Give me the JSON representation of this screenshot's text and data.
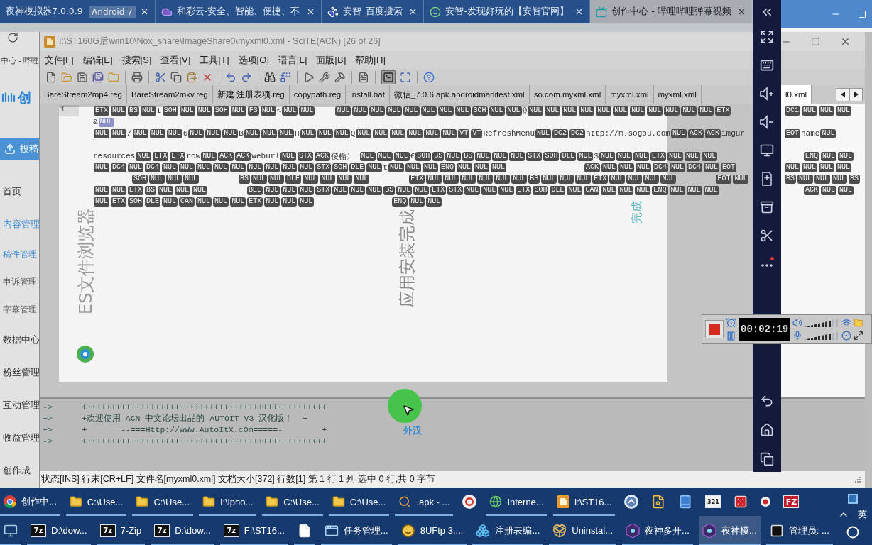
{
  "browser": {
    "tabs": [
      {
        "kind": "plain",
        "title": "夜神模拟器7.0.0.9",
        "subtitle": "Android 7",
        "selected": false
      },
      {
        "kind": "cloud",
        "title": "和彩云-安全、智能、便捷、不",
        "selected": false
      },
      {
        "kind": "paw",
        "title": "安智_百度搜索",
        "selected": false
      },
      {
        "kind": "smile",
        "title": "安智-发现好玩的【安智官网】",
        "selected": false
      },
      {
        "kind": "tv",
        "title": "创作中心 - 哔哩哔哩弹幕视频",
        "selected": true
      }
    ],
    "page_title": "中心 - 哔哩",
    "logo_text": "创",
    "upload_button": "投稿",
    "sidebar": [
      {
        "label": "首页",
        "selected": false
      },
      {
        "label": "内容管理",
        "selected": false,
        "expanded": true,
        "children": [
          {
            "label": "稿件管理",
            "selected": true
          },
          {
            "label": "申诉管理",
            "selected": false
          },
          {
            "label": "字幕管理",
            "selected": false
          }
        ]
      },
      {
        "label": "数据中心",
        "selected": false
      },
      {
        "label": "粉丝管理",
        "selected": false
      },
      {
        "label": "互动管理",
        "selected": false
      },
      {
        "label": "收益管理",
        "selected": false
      },
      {
        "label": "创作成",
        "selected": false
      }
    ]
  },
  "editor_window": {
    "title": "I:\\ST160G后\\win10\\Nox_share\\ImageShare0\\myxml0.xml - SciTE(ACN) [26 of 26]",
    "menu": [
      "文件[F]",
      "编辑[E]",
      "搜索[S]",
      "查看[V]",
      "工具[T]",
      "选项[O]",
      "语言[L]",
      "面版[B]",
      "帮助[H]"
    ],
    "output_pane_on": true,
    "tabs": [
      {
        "label": "BareStream2mp4.reg",
        "selected": false
      },
      {
        "label": "BareStream2mkv.reg",
        "selected": false
      },
      {
        "label": "新建 注册表项.reg",
        "selected": false
      },
      {
        "label": "copypath.reg",
        "selected": false
      },
      {
        "label": "install.bat",
        "selected": false
      },
      {
        "label": "微信_7.0.6.apk.androidmanifest.xml",
        "selected": false
      },
      {
        "label": "so.com.myxml.xml",
        "selected": false
      },
      {
        "label": "myxml.xml",
        "selected": false
      },
      {
        "label": "myxml.xml",
        "selected": false
      }
    ],
    "tabs_right": [
      {
        "label": "l0.xml",
        "selected": true
      }
    ],
    "line_number": "1",
    "blocks": [
      {
        "lines": [
          {
            "left": [
              {
                "kind": "ctrl",
                "text": "ETX"
              },
              {
                "kind": "ctrl",
                "text": "NUL"
              },
              {
                "kind": "ctrl",
                "text": "BS"
              },
              {
                "kind": "ctrl",
                "text": "NUL"
              },
              {
                "kind": "text",
                "text": "t"
              },
              {
                "kind": "ctrl",
                "text": "SOH"
              },
              {
                "kind": "ctrl",
                "text": "NUL"
              },
              {
                "kind": "ctrl",
                "text": "NUL"
              },
              {
                "kind": "ctrl",
                "text": "SOH"
              },
              {
                "kind": "ctrl",
                "text": "NUL"
              },
              {
                "kind": "ctrl",
                "text": "FS"
              },
              {
                "kind": "ctrl",
                "text": "NUL"
              },
              {
                "kind": "text",
                "text": "<"
              },
              {
                "kind": "ctrl",
                "text": "NUL"
              },
              {
                "kind": "ctrl",
                "text": "NUL"
              },
              {
                "kind": "gap"
              },
              {
                "kind": "ctrl",
                "text": "NUL"
              },
              {
                "kind": "ctrl",
                "text": "NUL"
              },
              {
                "kind": "ctrl",
                "text": "NUL"
              },
              {
                "kind": "ctrl",
                "text": "NUL"
              },
              {
                "kind": "ctrl",
                "text": "NUL"
              },
              {
                "kind": "ctrl",
                "text": "NUL"
              },
              {
                "kind": "ctrl",
                "text": "NUL"
              },
              {
                "kind": "ctrl",
                "text": "NUL"
              },
              {
                "kind": "ctrl",
                "text": "SOH"
              },
              {
                "kind": "ctrl",
                "text": "NUL"
              },
              {
                "kind": "ctrl",
                "text": "NUL"
              },
              {
                "kind": "text",
                "text": "@"
              },
              {
                "kind": "ctrl",
                "text": "NUL"
              },
              {
                "kind": "ctrl",
                "text": "NUL"
              },
              {
                "kind": "ctrl",
                "text": "NUL"
              },
              {
                "kind": "ctrl",
                "text": "NUL"
              },
              {
                "kind": "ctrl",
                "text": "NUL"
              },
              {
                "kind": "ctrl",
                "text": "NUL"
              },
              {
                "kind": "ctrl",
                "text": "NUL"
              },
              {
                "kind": "ctrl",
                "text": "NUL"
              },
              {
                "kind": "ctrl",
                "text": "NUL"
              },
              {
                "kind": "ctrl",
                "text": "NUL"
              },
              {
                "kind": "ctrl",
                "text": "NUL"
              },
              {
                "kind": "ctrl",
                "text": "ETX"
              }
            ],
            "right": [
              {
                "kind": "ctrl",
                "text": "DC1"
              },
              {
                "kind": "ctrl",
                "text": "NUL"
              },
              {
                "kind": "ctrl",
                "text": "NUL"
              },
              {
                "kind": "ctrl",
                "text": "NUL"
              }
            ]
          },
          {
            "left": [
              {
                "kind": "text",
                "text": "&"
              },
              {
                "kind": "marked",
                "text": "NUL"
              }
            ]
          },
          {
            "left": [
              {
                "kind": "ctrl",
                "text": "NUL"
              },
              {
                "kind": "ctrl",
                "text": "NUL"
              },
              {
                "kind": "text",
                "text": "/"
              },
              {
                "kind": "ctrl",
                "text": "NUL"
              },
              {
                "kind": "ctrl",
                "text": "NUL"
              },
              {
                "kind": "ctrl",
                "text": "NUL"
              },
              {
                "kind": "text",
                "text": "6"
              },
              {
                "kind": "ctrl",
                "text": "NUL"
              },
              {
                "kind": "ctrl",
                "text": "NUL"
              },
              {
                "kind": "ctrl",
                "text": "NUL"
              },
              {
                "kind": "text",
                "text": "B"
              },
              {
                "kind": "ctrl",
                "text": "NUL"
              },
              {
                "kind": "ctrl",
                "text": "NUL"
              },
              {
                "kind": "ctrl",
                "text": "NUL"
              },
              {
                "kind": "text",
                "text": "H"
              },
              {
                "kind": "ctrl",
                "text": "NUL"
              },
              {
                "kind": "ctrl",
                "text": "NUL"
              },
              {
                "kind": "ctrl",
                "text": "NUL"
              },
              {
                "kind": "text",
                "text": "Q"
              },
              {
                "kind": "ctrl",
                "text": "NUL"
              },
              {
                "kind": "ctrl",
                "text": "NUL"
              },
              {
                "kind": "ctrl",
                "text": "NUL"
              },
              {
                "kind": "ctrl",
                "text": "NUL"
              },
              {
                "kind": "ctrl",
                "text": "NUL"
              },
              {
                "kind": "ctrl",
                "text": "NUL"
              },
              {
                "kind": "ctrl",
                "text": "VT"
              },
              {
                "kind": "ctrl",
                "text": "VT"
              },
              {
                "kind": "text",
                "text": "RefreshMenu"
              },
              {
                "kind": "ctrl",
                "text": "NUL"
              },
              {
                "kind": "ctrl",
                "text": "DC2"
              },
              {
                "kind": "ctrl",
                "text": "DC2"
              },
              {
                "kind": "text",
                "text": "http://m.sogou.com"
              },
              {
                "kind": "ctrl",
                "text": "NUL"
              },
              {
                "kind": "ctrl",
                "text": "ACK"
              },
              {
                "kind": "ctrl",
                "text": "ACK"
              },
              {
                "kind": "text",
                "text": "imgur"
              }
            ],
            "right": [
              {
                "kind": "ctrl",
                "text": "EOT"
              },
              {
                "kind": "text",
                "text": "name"
              },
              {
                "kind": "ctrl",
                "text": "NUL"
              }
            ]
          }
        ]
      },
      {
        "lines": [
          {
            "left": [
              {
                "kind": "text",
                "text": "resources"
              },
              {
                "kind": "ctrl",
                "text": "NUL"
              },
              {
                "kind": "ctrl",
                "text": "ETX"
              },
              {
                "kind": "ctrl",
                "text": "ETX"
              },
              {
                "kind": "text",
                "text": "row"
              },
              {
                "kind": "ctrl",
                "text": "NUL"
              },
              {
                "kind": "ctrl",
                "text": "ACK"
              },
              {
                "kind": "ctrl",
                "text": "ACK"
              },
              {
                "kind": "text",
                "text": "weburl"
              },
              {
                "kind": "ctrl",
                "text": "NUL"
              },
              {
                "kind": "ctrl",
                "text": "STX"
              },
              {
                "kind": "ctrl",
                "text": "ACK"
              },
              {
                "kind": "text",
                "text": "倰楯〉 "
              },
              {
                "kind": "ctrl",
                "text": "NUL"
              },
              {
                "kind": "ctrl",
                "text": "NUL"
              },
              {
                "kind": "ctrl",
                "text": "NUL"
              },
              {
                "kind": "text",
                "text": "€"
              },
              {
                "kind": "ctrl",
                "text": "SOH"
              },
              {
                "kind": "ctrl",
                "text": "BS"
              },
              {
                "kind": "ctrl",
                "text": "NUL"
              },
              {
                "kind": "ctrl",
                "text": "BS"
              },
              {
                "kind": "ctrl",
                "text": "NUL"
              },
              {
                "kind": "ctrl",
                "text": "NUL"
              },
              {
                "kind": "ctrl",
                "text": "NUL"
              },
              {
                "kind": "ctrl",
                "text": "STX"
              },
              {
                "kind": "ctrl",
                "text": "SOH"
              },
              {
                "kind": "ctrl",
                "text": "DLE"
              },
              {
                "kind": "ctrl",
                "text": "NUL"
              },
              {
                "kind": "text",
                "text": "$"
              },
              {
                "kind": "ctrl",
                "text": "NUL"
              },
              {
                "kind": "ctrl",
                "text": "NUL"
              },
              {
                "kind": "ctrl",
                "text": "NUL"
              },
              {
                "kind": "ctrl",
                "text": "ETX"
              },
              {
                "kind": "ctrl",
                "text": "NUL"
              },
              {
                "kind": "ctrl",
                "text": "NUL"
              },
              {
                "kind": "ctrl",
                "text": "NUL"
              }
            ],
            "right": [
              {
                "kind": "gap"
              },
              {
                "kind": "ctrl",
                "text": "ENQ"
              },
              {
                "kind": "ctrl",
                "text": "NUL"
              },
              {
                "kind": "ctrl",
                "text": "NUL"
              }
            ]
          },
          {
            "left": [
              {
                "kind": "ctrl",
                "text": "NUL"
              },
              {
                "kind": "ctrl",
                "text": "DC4"
              },
              {
                "kind": "ctrl",
                "text": "NUL"
              },
              {
                "kind": "ctrl",
                "text": "DC4"
              },
              {
                "kind": "ctrl",
                "text": "NUL"
              },
              {
                "kind": "ctrl",
                "text": "NUL"
              },
              {
                "kind": "ctrl",
                "text": "NUL"
              },
              {
                "kind": "ctrl",
                "text": "NUL"
              },
              {
                "kind": "ctrl",
                "text": "NUL"
              },
              {
                "kind": "ctrl",
                "text": "NUL"
              },
              {
                "kind": "ctrl",
                "text": "NUL"
              },
              {
                "kind": "ctrl",
                "text": "NUL"
              },
              {
                "kind": "ctrl",
                "text": "NUL"
              },
              {
                "kind": "ctrl",
                "text": "STX"
              },
              {
                "kind": "ctrl",
                "text": "SOH"
              },
              {
                "kind": "ctrl",
                "text": "DLE"
              },
              {
                "kind": "ctrl",
                "text": "NUL"
              },
              {
                "kind": "text",
                "text": "t"
              },
              {
                "kind": "ctrl",
                "text": "NUL"
              },
              {
                "kind": "ctrl",
                "text": "NUL"
              },
              {
                "kind": "ctrl",
                "text": "NUL"
              },
              {
                "kind": "ctrl",
                "text": "ENQ"
              },
              {
                "kind": "ctrl",
                "text": "NUL"
              },
              {
                "kind": "ctrl",
                "text": "NUL"
              },
              {
                "kind": "ctrl",
                "text": "NUL"
              },
              {
                "kind": "gap"
              },
              {
                "kind": "gap"
              },
              {
                "kind": "gap"
              },
              {
                "kind": "gap"
              },
              {
                "kind": "ctrl",
                "text": "ACK"
              },
              {
                "kind": "ctrl",
                "text": "NUL"
              },
              {
                "kind": "ctrl",
                "text": "NUL"
              },
              {
                "kind": "ctrl",
                "text": "NUL"
              },
              {
                "kind": "ctrl",
                "text": "DC4"
              },
              {
                "kind": "ctrl",
                "text": "NUL"
              },
              {
                "kind": "ctrl",
                "text": "DC4"
              },
              {
                "kind": "ctrl",
                "text": "NUL"
              },
              {
                "kind": "ctrl",
                "text": "EOT"
              }
            ],
            "right": [
              {
                "kind": "ctrl",
                "text": "NUL"
              },
              {
                "kind": "ctrl",
                "text": "NUL"
              },
              {
                "kind": "ctrl",
                "text": "NUL"
              },
              {
                "kind": "ctrl",
                "text": "NUL"
              }
            ]
          },
          {
            "left": [
              {
                "kind": "gap"
              },
              {
                "kind": "gap"
              },
              {
                "kind": "ctrl",
                "text": "SOH"
              },
              {
                "kind": "ctrl",
                "text": "NUL"
              },
              {
                "kind": "ctrl",
                "text": "NUL"
              },
              {
                "kind": "ctrl",
                "text": "NUL"
              },
              {
                "kind": "gap"
              },
              {
                "kind": "gap"
              },
              {
                "kind": "ctrl",
                "text": "BS"
              },
              {
                "kind": "ctrl",
                "text": "NUL"
              },
              {
                "kind": "ctrl",
                "text": "NUL"
              },
              {
                "kind": "ctrl",
                "text": "DLE"
              },
              {
                "kind": "ctrl",
                "text": "NUL"
              },
              {
                "kind": "ctrl",
                "text": "NUL"
              },
              {
                "kind": "ctrl",
                "text": "NUL"
              },
              {
                "kind": "ctrl",
                "text": "NUL"
              },
              {
                "kind": "gap"
              },
              {
                "kind": "gap"
              },
              {
                "kind": "ctrl",
                "text": "ETX"
              },
              {
                "kind": "ctrl",
                "text": "NUL"
              },
              {
                "kind": "ctrl",
                "text": "NUL"
              },
              {
                "kind": "ctrl",
                "text": "NUL"
              },
              {
                "kind": "ctrl",
                "text": "NUL"
              },
              {
                "kind": "ctrl",
                "text": "NUL"
              },
              {
                "kind": "ctrl",
                "text": "NUL"
              },
              {
                "kind": "ctrl",
                "text": "BS"
              },
              {
                "kind": "ctrl",
                "text": "NUL"
              },
              {
                "kind": "ctrl",
                "text": "NUL"
              },
              {
                "kind": "ctrl",
                "text": "NUL"
              },
              {
                "kind": "ctrl",
                "text": "ETX"
              },
              {
                "kind": "ctrl",
                "text": "NUL"
              },
              {
                "kind": "ctrl",
                "text": "NUL"
              },
              {
                "kind": "ctrl",
                "text": "NUL"
              },
              {
                "kind": "ctrl",
                "text": "NUL"
              },
              {
                "kind": "gap"
              },
              {
                "kind": "gap"
              },
              {
                "kind": "ctrl",
                "text": "EOT"
              },
              {
                "kind": "ctrl",
                "text": "NUL"
              }
            ],
            "right": [
              {
                "kind": "ctrl",
                "text": "BS"
              },
              {
                "kind": "ctrl",
                "text": "NUL"
              },
              {
                "kind": "ctrl",
                "text": "NUL"
              },
              {
                "kind": "ctrl",
                "text": "NUL"
              },
              {
                "kind": "ctrl",
                "text": "BS"
              }
            ]
          },
          {
            "left": [
              {
                "kind": "ctrl",
                "text": "NUL"
              },
              {
                "kind": "ctrl",
                "text": "NUL"
              },
              {
                "kind": "ctrl",
                "text": "ETX"
              },
              {
                "kind": "ctrl",
                "text": "BS"
              },
              {
                "kind": "ctrl",
                "text": "NUL"
              },
              {
                "kind": "ctrl",
                "text": "NUL"
              },
              {
                "kind": "ctrl",
                "text": "NUL"
              },
              {
                "kind": "gap"
              },
              {
                "kind": "gap"
              },
              {
                "kind": "ctrl",
                "text": "BEL"
              },
              {
                "kind": "ctrl",
                "text": "NUL"
              },
              {
                "kind": "ctrl",
                "text": "NUL"
              },
              {
                "kind": "ctrl",
                "text": "NUL"
              },
              {
                "kind": "ctrl",
                "text": "STX"
              },
              {
                "kind": "ctrl",
                "text": "NUL"
              },
              {
                "kind": "ctrl",
                "text": "NUL"
              },
              {
                "kind": "ctrl",
                "text": "NUL"
              },
              {
                "kind": "ctrl",
                "text": "BS"
              },
              {
                "kind": "ctrl",
                "text": "NUL"
              },
              {
                "kind": "ctrl",
                "text": "NUL"
              },
              {
                "kind": "ctrl",
                "text": "ETX"
              },
              {
                "kind": "ctrl",
                "text": "STX"
              },
              {
                "kind": "ctrl",
                "text": "NUL"
              },
              {
                "kind": "ctrl",
                "text": "NUL"
              },
              {
                "kind": "ctrl",
                "text": "NUL"
              },
              {
                "kind": "ctrl",
                "text": "ETX"
              },
              {
                "kind": "ctrl",
                "text": "SOH"
              },
              {
                "kind": "ctrl",
                "text": "DLE"
              },
              {
                "kind": "ctrl",
                "text": "NUL"
              },
              {
                "kind": "ctrl",
                "text": "CAN"
              },
              {
                "kind": "ctrl",
                "text": "NUL"
              },
              {
                "kind": "ctrl",
                "text": "NUL"
              },
              {
                "kind": "ctrl",
                "text": "NUL"
              },
              {
                "kind": "ctrl",
                "text": "ENQ"
              },
              {
                "kind": "ctrl",
                "text": "NUL"
              },
              {
                "kind": "ctrl",
                "text": "NUL"
              },
              {
                "kind": "ctrl",
                "text": "NUL"
              }
            ],
            "right": [
              {
                "kind": "gap"
              },
              {
                "kind": "ctrl",
                "text": "ACK"
              },
              {
                "kind": "ctrl",
                "text": "NUL"
              },
              {
                "kind": "ctrl",
                "text": "NUL"
              }
            ]
          },
          {
            "left": [
              {
                "kind": "ctrl",
                "text": "NUL"
              },
              {
                "kind": "ctrl",
                "text": "ETX"
              },
              {
                "kind": "ctrl",
                "text": "SOH"
              },
              {
                "kind": "ctrl",
                "text": "DLE"
              },
              {
                "kind": "ctrl",
                "text": "NUL"
              },
              {
                "kind": "ctrl",
                "text": "CAN"
              },
              {
                "kind": "ctrl",
                "text": "NUL"
              },
              {
                "kind": "ctrl",
                "text": "NUL"
              },
              {
                "kind": "ctrl",
                "text": "NUL"
              },
              {
                "kind": "ctrl",
                "text": "ETX"
              },
              {
                "kind": "ctrl",
                "text": "NUL"
              },
              {
                "kind": "ctrl",
                "text": "NUL"
              },
              {
                "kind": "ctrl",
                "text": "NUL"
              },
              {
                "kind": "gap"
              },
              {
                "kind": "gap"
              },
              {
                "kind": "gap"
              },
              {
                "kind": "gap"
              },
              {
                "kind": "ctrl",
                "text": "ENQ"
              },
              {
                "kind": "ctrl",
                "text": "NUL"
              },
              {
                "kind": "ctrl",
                "text": "NUL"
              }
            ]
          }
        ]
      }
    ],
    "output": [
      {
        "prefix": "->",
        "text": "++++++++++++++++++++++++++++++++++++++++++++++++++"
      },
      {
        "prefix": "+>",
        "text": "+欢迎使用 ACN 中文论坛出品的 AUTOIT V3 汉化版！  +"
      },
      {
        "prefix": "+>",
        "text": "+       --===Http://wWw.AutoItX.cOm=====-        +"
      },
      {
        "prefix": "->",
        "text": "++++++++++++++++++++++++++++++++++++++++++++++++++"
      }
    ],
    "status": "状态[INS] 行末[CR+LF] 文件名[myxml0.xml] 文档大小[372] 行数[1] 第 1 行 1 列 选中 0 行,共 0 字节"
  },
  "emulator_screen": {
    "app_name": "ES文件浏览器",
    "install_status": "应用安装完成",
    "done_button": "完成"
  },
  "recorder": {
    "timer": "00:02:19",
    "meters": [
      {
        "kind": "speaker",
        "level": 0.8
      },
      {
        "kind": "microphone",
        "level": 0.8
      }
    ]
  },
  "cursor_caption": "外汉",
  "taskbar": {
    "upper_row": [
      {
        "kind": "chrome",
        "label": "创作中...",
        "running": true,
        "selected": false
      },
      {
        "kind": "folder",
        "label": "C:\\Use...",
        "running": true,
        "selected": false
      },
      {
        "kind": "folder",
        "label": "C:\\Use...",
        "running": true,
        "selected": false
      },
      {
        "kind": "folder",
        "label": "I:\\ipho...",
        "running": true,
        "selected": false
      },
      {
        "kind": "folder",
        "label": "C:\\Use...",
        "running": true,
        "selected": false
      },
      {
        "kind": "folder",
        "label": "C:\\Use...",
        "running": true,
        "selected": false
      },
      {
        "kind": "search",
        "label": ".apk - ...",
        "running": true,
        "selected": false
      },
      {
        "kind": "record",
        "running": false,
        "selected": false
      },
      {
        "kind": "globe",
        "label": "Interne...",
        "running": true,
        "selected": false
      },
      {
        "kind": "editor",
        "label": "I:\\ST16...",
        "running": true,
        "selected": false
      },
      {
        "kind": "circle_app",
        "running": false,
        "selected": false
      },
      {
        "kind": "doc_search",
        "running": false,
        "selected": false
      },
      {
        "kind": "book",
        "running": false,
        "selected": false
      },
      {
        "kind": "media",
        "icon_text": "321",
        "running": false,
        "selected": false
      },
      {
        "kind": "dice",
        "running": false,
        "selected": false
      },
      {
        "kind": "dot",
        "running": false,
        "selected": false
      },
      {
        "kind": "filezilla",
        "icon_text": "FZ",
        "running": false,
        "selected": false
      }
    ],
    "lower_row": [
      {
        "kind": "computer",
        "running": true,
        "selected": false
      },
      {
        "kind": "sevenzip",
        "icon_text": "7z",
        "label": "D:\\dow...",
        "running": true,
        "selected": false
      },
      {
        "kind": "sevenzip",
        "icon_text": "7z",
        "label": "7-Zip",
        "running": true,
        "selected": false
      },
      {
        "kind": "sevenzip",
        "icon_text": "7z",
        "label": "D:\\dow...",
        "running": true,
        "selected": false
      },
      {
        "kind": "sevenzip",
        "icon_text": "7z",
        "label": "F:\\ST16...",
        "running": true,
        "selected": false
      },
      {
        "kind": "file",
        "running": true,
        "selected": false
      },
      {
        "kind": "taskmgr",
        "label": "任务管理...",
        "running": true,
        "selected": false
      },
      {
        "kind": "ftp",
        "label": "8UFtp 3....",
        "running": true,
        "selected": false
      },
      {
        "kind": "regedit",
        "label": "注册表编...",
        "running": true,
        "selected": false
      },
      {
        "kind": "uninstall",
        "label": "Uninstal...",
        "running": true,
        "selected": false
      },
      {
        "kind": "nox",
        "label": "夜神多开...",
        "running": true,
        "selected": false
      },
      {
        "kind": "nox",
        "label": "夜神模...",
        "running": true,
        "selected": true
      },
      {
        "kind": "cmd",
        "label": "管理员: ...",
        "running": true,
        "selected": false
      }
    ],
    "tray": {
      "language": "英"
    }
  }
}
